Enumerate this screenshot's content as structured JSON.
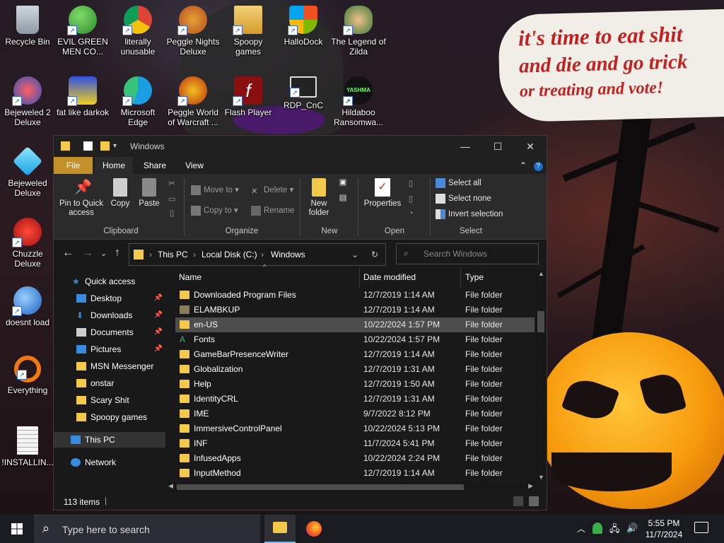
{
  "desktop": {
    "icons": [
      {
        "label": "Recycle Bin"
      },
      {
        "label": "EVIL GREEN MEN CO..."
      },
      {
        "label": "literally unusable"
      },
      {
        "label": "Peggle Nights Deluxe"
      },
      {
        "label": "Spoopy games"
      },
      {
        "label": "HalloDock"
      },
      {
        "label": "The Legend of Zilda"
      },
      {
        "label": "Bejeweled 2 Deluxe"
      },
      {
        "label": "fat like darkok"
      },
      {
        "label": "Microsoft Edge"
      },
      {
        "label": "Peggle World of Warcraft ..."
      },
      {
        "label": "Flash Player"
      },
      {
        "label": "RDP_CnC"
      },
      {
        "label": "Hildaboo Ransomwa..."
      },
      {
        "label": "Bejeweled Deluxe"
      },
      {
        "label": "Chuzzle Deluxe"
      },
      {
        "label": "doesnt load"
      },
      {
        "label": "Everything"
      },
      {
        "label": "!INSTALLIN..."
      }
    ],
    "bubble_lines": [
      "it's time to eat shit",
      "and die and go trick",
      "or treating and vote!"
    ]
  },
  "explorer": {
    "title": "Windows",
    "tabs": {
      "file": "File",
      "home": "Home",
      "share": "Share",
      "view": "View"
    },
    "ribbon": {
      "pin": "Pin to Quick access",
      "copy": "Copy",
      "paste": "Paste",
      "clipboard": "Clipboard",
      "move_to": "Move to",
      "copy_to": "Copy to",
      "delete": "Delete",
      "rename": "Rename",
      "organize": "Organize",
      "new_folder": "New folder",
      "new": "New",
      "properties": "Properties",
      "open": "Open",
      "select_all": "Select all",
      "select_none": "Select none",
      "invert_selection": "Invert selection",
      "select": "Select"
    },
    "address": {
      "crumbs": [
        "This PC",
        "Local Disk (C:)",
        "Windows"
      ]
    },
    "search_placeholder": "Search Windows",
    "nav": {
      "quick_access": "Quick access",
      "items": [
        {
          "label": "Desktop",
          "pinned": true
        },
        {
          "label": "Downloads",
          "pinned": true
        },
        {
          "label": "Documents",
          "pinned": true
        },
        {
          "label": "Pictures",
          "pinned": true
        },
        {
          "label": "MSN Messenger"
        },
        {
          "label": "onstar"
        },
        {
          "label": "Scary Shit"
        },
        {
          "label": "Spoopy games"
        }
      ],
      "this_pc": "This PC",
      "network": "Network"
    },
    "columns": {
      "name": "Name",
      "date": "Date modified",
      "type": "Type"
    },
    "files": [
      {
        "name": "Downloaded Program Files",
        "date": "12/7/2019 1:14 AM",
        "type": "File folder"
      },
      {
        "name": "ELAMBKUP",
        "date": "12/7/2019 1:14 AM",
        "type": "File folder"
      },
      {
        "name": "en-US",
        "date": "10/22/2024 1:57 PM",
        "type": "File folder"
      },
      {
        "name": "Fonts",
        "date": "10/22/2024 1:57 PM",
        "type": "File folder"
      },
      {
        "name": "GameBarPresenceWriter",
        "date": "12/7/2019 1:14 AM",
        "type": "File folder"
      },
      {
        "name": "Globalization",
        "date": "12/7/2019 1:31 AM",
        "type": "File folder"
      },
      {
        "name": "Help",
        "date": "12/7/2019 1:50 AM",
        "type": "File folder"
      },
      {
        "name": "IdentityCRL",
        "date": "12/7/2019 1:31 AM",
        "type": "File folder"
      },
      {
        "name": "IME",
        "date": "9/7/2022 8:12 PM",
        "type": "File folder"
      },
      {
        "name": "ImmersiveControlPanel",
        "date": "10/22/2024 5:13 PM",
        "type": "File folder"
      },
      {
        "name": "INF",
        "date": "11/7/2024 5:41 PM",
        "type": "File folder"
      },
      {
        "name": "InfusedApps",
        "date": "10/22/2024 2:24 PM",
        "type": "File folder"
      },
      {
        "name": "InputMethod",
        "date": "12/7/2019 1:14 AM",
        "type": "File folder"
      }
    ],
    "status": "113 items"
  },
  "taskbar": {
    "search_placeholder": "Type here to search",
    "time": "5:55 PM",
    "date": "11/7/2024"
  },
  "colors": {
    "accent": "#0078d7",
    "file_tab": "#c4902a",
    "folder": "#f2c94a"
  }
}
